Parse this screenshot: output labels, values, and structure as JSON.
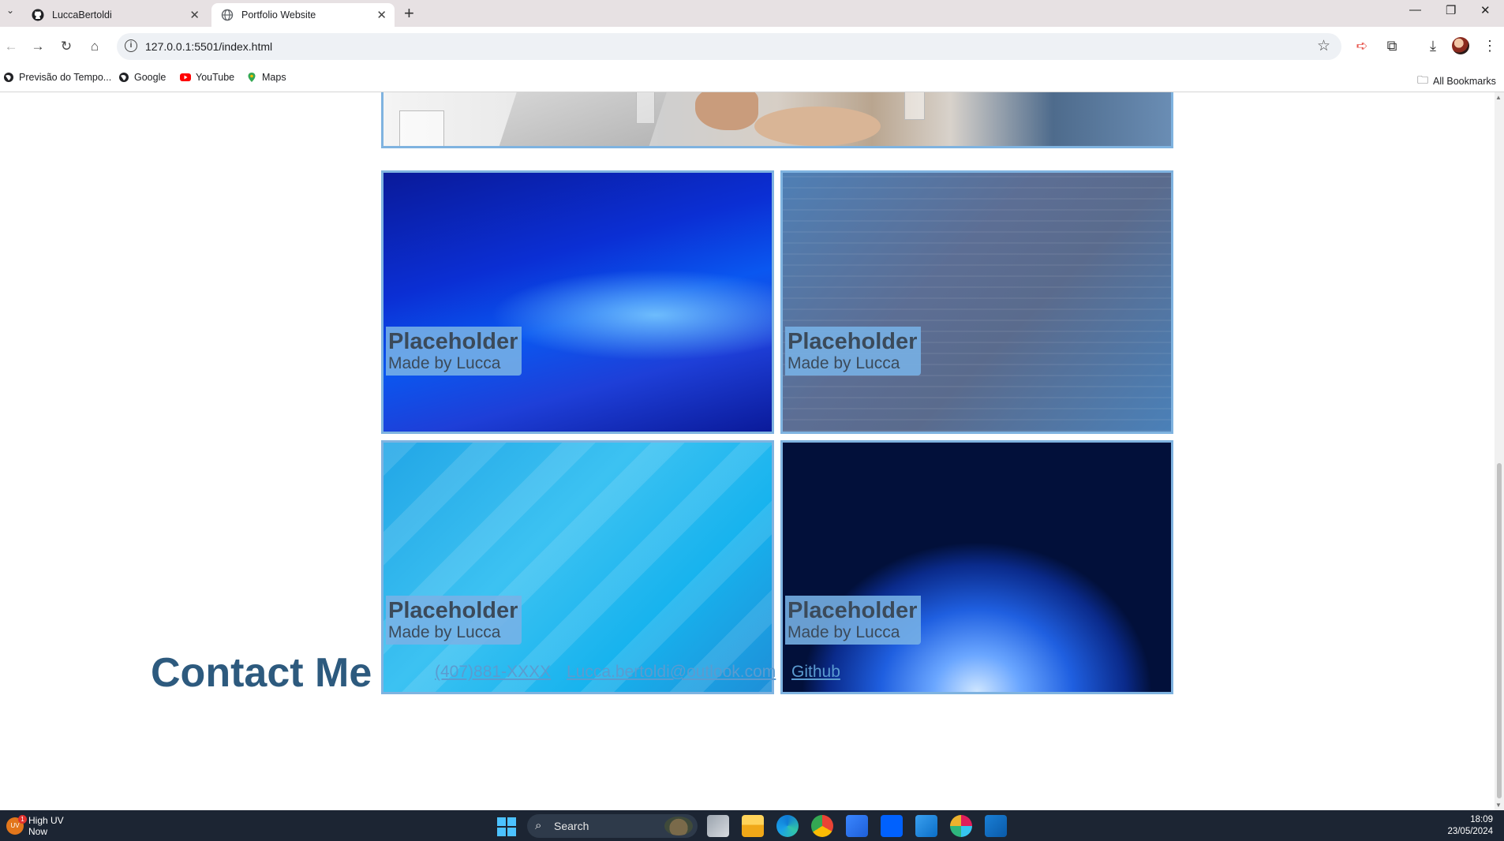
{
  "browser": {
    "tabs": [
      {
        "title": "LuccaBertoldi",
        "icon": "github-icon",
        "active": false
      },
      {
        "title": "Portfolio Website",
        "icon": "globe-icon",
        "active": true
      }
    ],
    "url": "127.0.0.1:5501/index.html",
    "bookmarks": [
      {
        "label": "Previsão do Tempo...",
        "icon": "globe-icon"
      },
      {
        "label": "Google",
        "icon": "globe-icon"
      },
      {
        "label": "YouTube",
        "icon": "youtube-icon"
      },
      {
        "label": "Maps",
        "icon": "maps-icon"
      }
    ],
    "all_bookmarks_label": "All Bookmarks"
  },
  "gallery": {
    "cards": [
      {
        "title": "Placeholder",
        "subtitle": "Made by Lucca"
      },
      {
        "title": "Placeholder",
        "subtitle": "Made by Lucca"
      },
      {
        "title": "Placeholder",
        "subtitle": "Made by Lucca"
      },
      {
        "title": "Placeholder",
        "subtitle": "Made by Lucca"
      }
    ]
  },
  "contact": {
    "title": "Contact Me",
    "phone": "(407)881-XXXX",
    "email": "Lucca.bertoldi@outlook.com",
    "github": "Github"
  },
  "taskbar": {
    "weather_label": "High UV",
    "weather_time": "Now",
    "weather_badge": "1",
    "weather_icon_text": "UV",
    "search_label": "Search",
    "time": "18:09",
    "date": "23/05/2024"
  },
  "colors": {
    "accent_border": "#7fb3e0",
    "caption_bg": "#78b2e6",
    "contact_title": "#2d5a7e",
    "link": "#5b9bd0"
  }
}
